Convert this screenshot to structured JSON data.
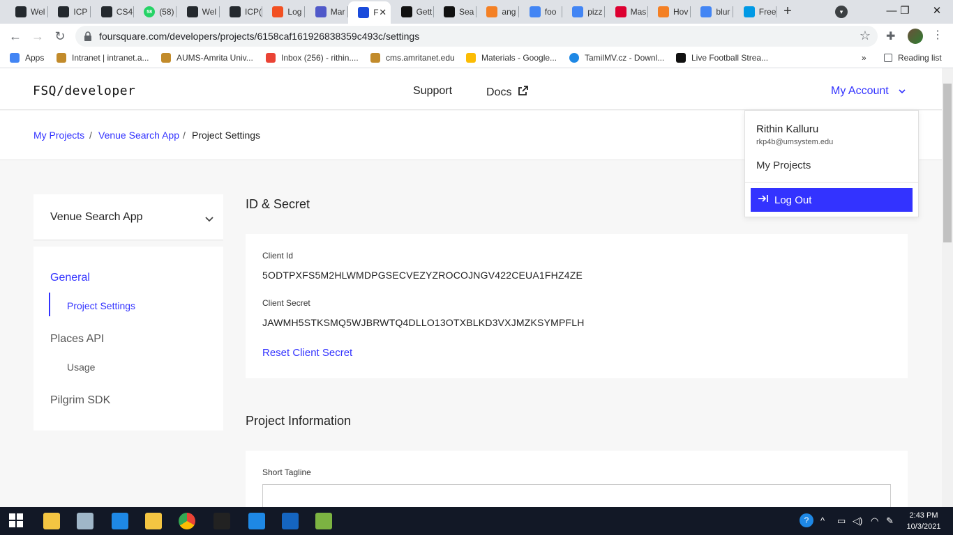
{
  "browser": {
    "tabs": [
      {
        "label": "Wel",
        "icon": "github-icon",
        "color": "#24292e"
      },
      {
        "label": "ICP",
        "icon": "github-icon",
        "color": "#24292e"
      },
      {
        "label": "CS4",
        "icon": "github-icon",
        "color": "#24292e"
      },
      {
        "label": "(58)",
        "icon": "whatsapp-icon",
        "color": "#25d366",
        "badge": "58"
      },
      {
        "label": "Wel",
        "icon": "github-icon",
        "color": "#24292e"
      },
      {
        "label": "ICP(",
        "icon": "github-icon",
        "color": "#24292e"
      },
      {
        "label": "Log",
        "icon": "microsoft-icon",
        "color": "#f25022"
      },
      {
        "label": "Mar",
        "icon": "teams-icon",
        "color": "#5059c9"
      },
      {
        "label": "F",
        "icon": "foursquare-icon",
        "color": "#1a4bdb",
        "active": true,
        "close": "✕"
      },
      {
        "label": "Gett",
        "icon": "fsq-icon",
        "color": "#111111"
      },
      {
        "label": "Sea",
        "icon": "fsq-icon",
        "color": "#111111"
      },
      {
        "label": "ang",
        "icon": "stackoverflow-icon",
        "color": "#f48024"
      },
      {
        "label": "foo",
        "icon": "google-icon",
        "color": "#4285f4"
      },
      {
        "label": "pizz",
        "icon": "google-icon",
        "color": "#4285f4"
      },
      {
        "label": "Mas",
        "icon": "angular-icon",
        "color": "#dd0031"
      },
      {
        "label": "Hov",
        "icon": "stackoverflow-icon",
        "color": "#f48024"
      },
      {
        "label": "blur",
        "icon": "google-icon",
        "color": "#4285f4"
      },
      {
        "label": "Free",
        "icon": "ph-icon",
        "color": "#0099e5"
      }
    ],
    "new_tab": "+",
    "url": "foursquare.com/developers/projects/6158caf161926838359c493c/settings",
    "bookmarks": [
      {
        "label": "Apps",
        "icon": "apps-grid-icon",
        "color": "#4285f4"
      },
      {
        "label": "Intranet | intranet.a...",
        "icon": "amrita-icon",
        "color": "#c28b2b"
      },
      {
        "label": "AUMS-Amrita Univ...",
        "icon": "amrita-icon",
        "color": "#c28b2b"
      },
      {
        "label": "Inbox (256) - rithin....",
        "icon": "gmail-icon",
        "color": "#ea4335"
      },
      {
        "label": "cms.amritanet.edu",
        "icon": "amrita-icon",
        "color": "#c28b2b"
      },
      {
        "label": "Materials - Google...",
        "icon": "drive-icon",
        "color": "#fbbc04"
      },
      {
        "label": "TamilMV.cz - Downl...",
        "icon": "play-icon",
        "color": "#1e88e5"
      },
      {
        "label": "Live Football Strea...",
        "icon": "football-icon",
        "color": "#111111"
      }
    ],
    "bookmarks_overflow": "»",
    "reading_list": "Reading list"
  },
  "site": {
    "logo": "FSQ/developer",
    "nav": {
      "support": "Support",
      "docs": "Docs",
      "my_account": "My Account"
    },
    "accent": "#3333ff"
  },
  "breadcrumb": {
    "items": [
      "My Projects",
      "Venue Search App",
      "Project Settings"
    ],
    "separator": "/"
  },
  "sidebar": {
    "project": "Venue Search App",
    "sections": [
      {
        "label": "General",
        "active": true,
        "subitems": [
          "Project Settings"
        ]
      },
      {
        "label": "Places API",
        "subitems": [
          "Usage"
        ]
      },
      {
        "label": "Pilgrim SDK",
        "subitems": []
      }
    ]
  },
  "main": {
    "id_secret_title": "ID & Secret",
    "client_id_label": "Client Id",
    "client_id": "5ODTPXFS5M2HLWMDPGSECVEZYZROCOJNGV422CEUA1FHZ4ZE",
    "client_secret_label": "Client Secret",
    "client_secret": "JAWMH5STKSMQ5WJBRWTQ4DLLO13OTXBLKD3VXJMZKSYMPFLH",
    "reset_label": "Reset Client Secret",
    "project_info_title": "Project Information",
    "short_tagline_label": "Short Tagline",
    "short_tagline_value": ""
  },
  "account_menu": {
    "name": "Rithin Kalluru",
    "email": "rkp4b@umsystem.edu",
    "my_projects": "My Projects",
    "logout": "Log Out"
  },
  "taskbar": {
    "time": "2:43 PM",
    "date": "10/3/2021",
    "apps": [
      "start-icon",
      "file-explorer-icon",
      "app-icon",
      "settings-sync-icon",
      "folder-icon",
      "chrome-icon",
      "terminal-icon",
      "settings-icon",
      "webstorm-icon",
      "notepad-icon"
    ]
  }
}
